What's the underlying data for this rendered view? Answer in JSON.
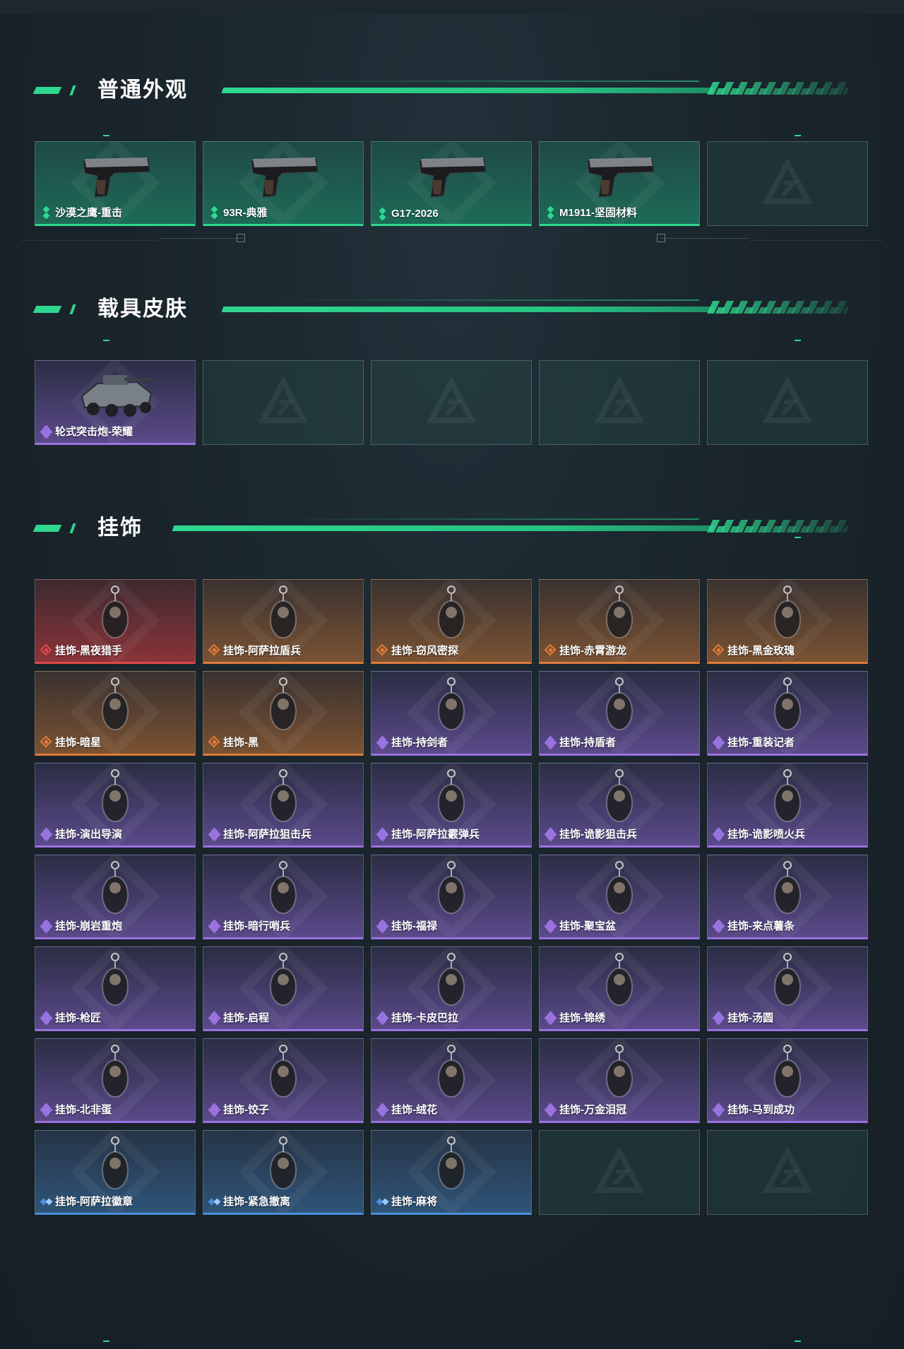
{
  "sections": [
    {
      "title": "普通外观",
      "items": [
        {
          "label": "沙漠之鹰-重击",
          "rarity": "green",
          "icon": "pistol-icon"
        },
        {
          "label": "93R-典雅",
          "rarity": "green",
          "icon": "pistol-icon"
        },
        {
          "label": "G17-2026",
          "rarity": "green",
          "icon": "pistol-icon"
        },
        {
          "label": "M1911-坚固材料",
          "rarity": "green",
          "icon": "pistol-icon"
        },
        {
          "label": "",
          "rarity": "empty",
          "icon": "empty-slot-icon"
        }
      ]
    },
    {
      "title": "载具皮肤",
      "items": [
        {
          "label": "轮式突击炮-荣耀",
          "rarity": "purple",
          "icon": "vehicle-icon"
        },
        {
          "label": "",
          "rarity": "empty",
          "icon": "empty-slot-icon"
        },
        {
          "label": "",
          "rarity": "empty",
          "icon": "empty-slot-icon"
        },
        {
          "label": "",
          "rarity": "empty",
          "icon": "empty-slot-icon"
        },
        {
          "label": "",
          "rarity": "empty",
          "icon": "empty-slot-icon"
        }
      ]
    },
    {
      "title": "挂饰",
      "items": [
        {
          "label": "挂饰-黑夜猎手",
          "rarity": "red",
          "icon": "charm-icon"
        },
        {
          "label": "挂饰-阿萨拉盾兵",
          "rarity": "orange",
          "icon": "charm-icon"
        },
        {
          "label": "挂饰-窃风密探",
          "rarity": "orange",
          "icon": "charm-icon"
        },
        {
          "label": "挂饰-赤霄游龙",
          "rarity": "orange",
          "icon": "charm-icon"
        },
        {
          "label": "挂饰-黑金玫瑰",
          "rarity": "orange",
          "icon": "charm-icon"
        },
        {
          "label": "挂饰-暗星",
          "rarity": "orange",
          "icon": "charm-icon"
        },
        {
          "label": "挂饰-黑",
          "rarity": "orange",
          "icon": "charm-icon"
        },
        {
          "label": "挂饰-持剑者",
          "rarity": "purple",
          "icon": "charm-icon"
        },
        {
          "label": "挂饰-持盾者",
          "rarity": "purple",
          "icon": "charm-icon"
        },
        {
          "label": "挂饰-重装记者",
          "rarity": "purple",
          "icon": "charm-icon"
        },
        {
          "label": "挂饰-演出导演",
          "rarity": "purple",
          "icon": "charm-icon"
        },
        {
          "label": "挂饰-阿萨拉狙击兵",
          "rarity": "purple",
          "icon": "charm-icon"
        },
        {
          "label": "挂饰-阿萨拉霰弹兵",
          "rarity": "purple",
          "icon": "charm-icon"
        },
        {
          "label": "挂饰-诡影狙击兵",
          "rarity": "purple",
          "icon": "charm-icon"
        },
        {
          "label": "挂饰-诡影喷火兵",
          "rarity": "purple",
          "icon": "charm-icon"
        },
        {
          "label": "挂饰-崩岩重炮",
          "rarity": "purple",
          "icon": "charm-icon"
        },
        {
          "label": "挂饰-暗行哨兵",
          "rarity": "purple",
          "icon": "charm-icon"
        },
        {
          "label": "挂饰-福禄",
          "rarity": "purple",
          "icon": "charm-icon"
        },
        {
          "label": "挂饰-聚宝盆",
          "rarity": "purple",
          "icon": "charm-icon"
        },
        {
          "label": "挂饰-来点薯条",
          "rarity": "purple",
          "icon": "charm-icon"
        },
        {
          "label": "挂饰-枪匠",
          "rarity": "purple",
          "icon": "charm-icon"
        },
        {
          "label": "挂饰-启程",
          "rarity": "purple",
          "icon": "charm-icon"
        },
        {
          "label": "挂饰-卡皮巴拉",
          "rarity": "purple",
          "icon": "charm-icon"
        },
        {
          "label": "挂饰-锦绣",
          "rarity": "purple",
          "icon": "charm-icon"
        },
        {
          "label": "挂饰-汤圆",
          "rarity": "purple",
          "icon": "charm-icon"
        },
        {
          "label": "挂饰-北非蛋",
          "rarity": "purple",
          "icon": "charm-icon"
        },
        {
          "label": "挂饰-饺子",
          "rarity": "purple",
          "icon": "charm-icon"
        },
        {
          "label": "挂饰-绒花",
          "rarity": "purple",
          "icon": "charm-icon"
        },
        {
          "label": "挂饰-万金泪冠",
          "rarity": "purple",
          "icon": "charm-icon"
        },
        {
          "label": "挂饰-马到成功",
          "rarity": "purple",
          "icon": "charm-icon"
        },
        {
          "label": "挂饰-阿萨拉徽章",
          "rarity": "blue",
          "icon": "charm-icon"
        },
        {
          "label": "挂饰-紧急撤离",
          "rarity": "blue",
          "icon": "charm-icon"
        },
        {
          "label": "挂饰-麻将",
          "rarity": "blue",
          "icon": "charm-icon"
        },
        {
          "label": "",
          "rarity": "empty",
          "icon": "empty-slot-icon"
        },
        {
          "label": "",
          "rarity": "empty",
          "icon": "empty-slot-icon"
        }
      ]
    }
  ],
  "colors": {
    "accent": "#2fd890",
    "green": "#2fd890",
    "purple": "#9a72e0",
    "orange": "#e07a3a",
    "red": "#e0484a",
    "blue": "#4a8ee0"
  }
}
